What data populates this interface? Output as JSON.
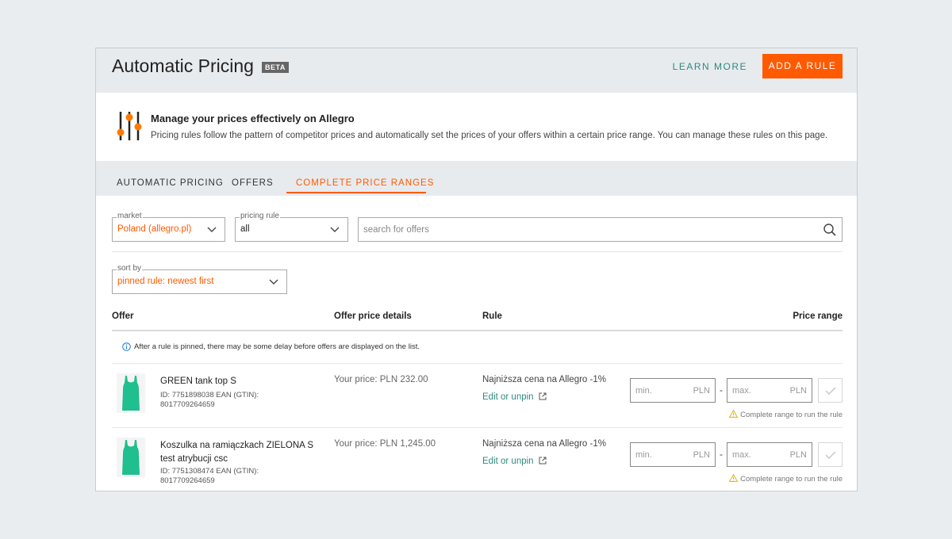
{
  "header": {
    "title": "Automatic Pricing",
    "beta_badge": "BETA",
    "learn_more": "LEARN MORE",
    "add_rule": "ADD A RULE"
  },
  "intro": {
    "icon": "sliders-icon",
    "title": "Manage your prices effectively on Allegro",
    "text": "Pricing rules follow the pattern of competitor prices and automatically set the prices of your offers within a certain price range. You can manage these rules on this page."
  },
  "tabs": [
    {
      "label": "AUTOMATIC PRICING",
      "active": false
    },
    {
      "label": "OFFERS",
      "active": false
    },
    {
      "label": "COMPLETE PRICE RANGES",
      "active": true
    }
  ],
  "filters": {
    "market_label": "market",
    "market_value": "Poland (allegro.pl)",
    "pricing_rule_label": "pricing rule",
    "pricing_rule_value": "all",
    "search_placeholder": "search for offers",
    "sort_label": "sort by",
    "sort_value": "pinned rule: newest first"
  },
  "table": {
    "headers": {
      "offer": "Offer",
      "price_details": "Offer price details",
      "rule": "Rule",
      "price_range": "Price range"
    },
    "info_note": "After a rule is pinned, there may be some delay before offers are displayed on the list.",
    "rows": [
      {
        "name_line1": "GREEN tank top S",
        "name_line2": "",
        "meta_line1": "ID: 7751898038 EAN (GTIN):",
        "meta_line2": "8017709264659",
        "price": "Your price: PLN 232.00",
        "rule": "Najniższa cena na Allegro -1%",
        "edit": "Edit or unpin",
        "min_placeholder": "min.",
        "max_placeholder": "max.",
        "currency": "PLN",
        "dash": "-",
        "warning": "Complete range to run the rule"
      },
      {
        "name_line1": "Koszulka na ramiączkach ZIELONA S",
        "name_line2": "test atrybucji csc",
        "meta_line1": "ID: 7751308474 EAN (GTIN):",
        "meta_line2": "8017709264659",
        "price": "Your price: PLN 1,245.00",
        "rule": "Najniższa cena na Allegro -1%",
        "edit": "Edit or unpin",
        "min_placeholder": "min.",
        "max_placeholder": "max.",
        "currency": "PLN",
        "dash": "-",
        "warning": "Complete range to run the rule"
      }
    ]
  },
  "colors": {
    "accent": "#ff5a00",
    "link": "#2d8a80",
    "product": "#1fbf8f"
  }
}
